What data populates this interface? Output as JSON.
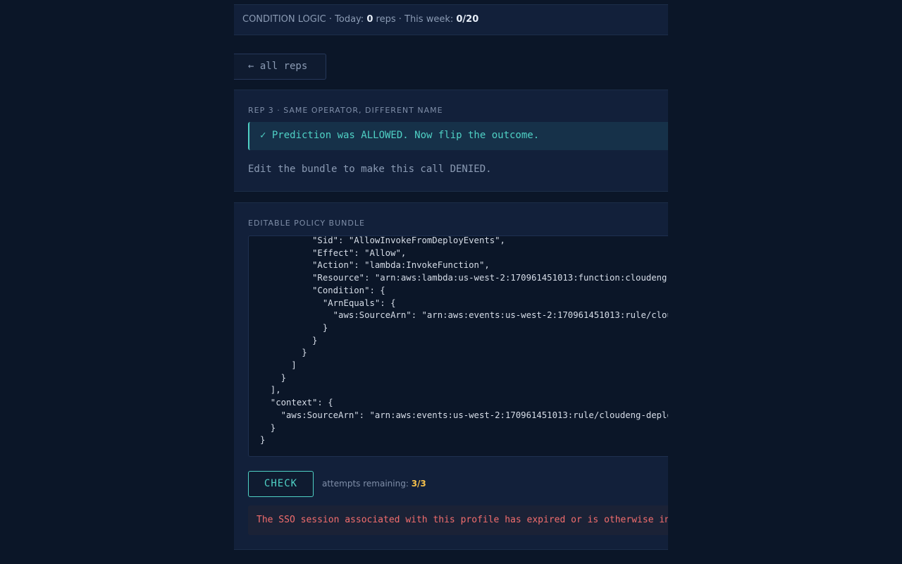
{
  "header": {
    "module": "CONDITION LOGIC",
    "sep1": " · ",
    "today_label": "Today: ",
    "today_count": "0",
    "today_unit": " reps",
    "sep2": " · ",
    "week_label": "This week: ",
    "week_count": "0/20"
  },
  "nav": {
    "back_label": "← all reps"
  },
  "rep": {
    "eyebrow": "REP 3 · SAME OPERATOR, DIFFERENT NAME",
    "notice": "✓ Prediction was ALLOWED. Now flip the outcome.",
    "instruction": "Edit the bundle to make this call DENIED."
  },
  "editor": {
    "eyebrow": "EDITABLE POLICY BUNDLE",
    "code": "          \"Sid\": \"AllowInvokeFromDeployEvents\",\n          \"Effect\": \"Allow\",\n          \"Action\": \"lambda:InvokeFunction\",\n          \"Resource\": \"arn:aws:lambda:us-west-2:170961451013:function:cloudeng-deploy-handler\",\n          \"Condition\": {\n            \"ArnEquals\": {\n              \"aws:SourceArn\": \"arn:aws:events:us-west-2:170961451013:rule/cloudeng-deploy-events\"\n            }\n          }\n        }\n      ]\n    }\n  ],\n  \"context\": {\n    \"aws:SourceArn\": \"arn:aws:events:us-west-2:170961451013:rule/cloudeng-deploy-events\"\n  }\n}"
  },
  "actions": {
    "check_label": "CHECK",
    "attempts_label": "attempts remaining: ",
    "attempts_value": "3/3"
  },
  "error": {
    "message": "The SSO session associated with this profile has expired or is otherwise invalid."
  },
  "colors": {
    "accent": "#4fd1c5",
    "warning": "#f6c14b",
    "error": "#f26d6d",
    "background": "#0b1628",
    "panel": "#12203a"
  }
}
